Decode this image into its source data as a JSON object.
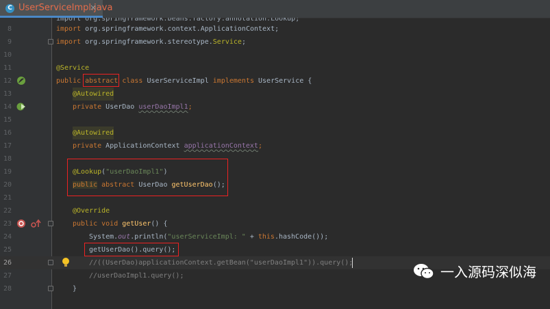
{
  "tab": {
    "title": "UserServiceImpl.java",
    "icon": "C"
  },
  "lines": {
    "7": "import org.springframework.beans.factory.annotation.Lookup;",
    "8": "8",
    "9": "9",
    "11": "11",
    "12": "12",
    "13": "13",
    "14": "14",
    "15": "15",
    "16": "16",
    "17": "17",
    "18": "18",
    "19": "19",
    "20": "20",
    "21": "21",
    "22": "22",
    "23": "23",
    "24": "24",
    "25": "25",
    "26": "26",
    "27": "27",
    "28": "28",
    "10": "10"
  },
  "code": {
    "l8_import": "import",
    "l8_path": " org.springframework.context.ApplicationContext;",
    "l9_import": "import",
    "l9_path": " org.springframework.stereotype.",
    "l9_service": "Service",
    "l9_end": ";",
    "l11": "@Service",
    "l12_public": "public",
    "l12_abstract": "abstract",
    "l12_class": " class",
    "l12_name": " UserServiceImpl ",
    "l12_implements": "implements",
    "l12_rest": " UserService {",
    "l13": "@Autowired",
    "l14_private": "private",
    "l14_type": " UserDao ",
    "l14_field": "userDaoImpl1",
    "l14_end": ";",
    "l16": "@Autowired",
    "l17_private": "private",
    "l17_type": " ApplicationContext ",
    "l17_field": "applicationContext",
    "l17_end": ";",
    "l19_ann": "@Lookup",
    "l19_open": "(",
    "l19_str": "\"userDaoImpl1\"",
    "l19_close": ")",
    "l20_public": "public",
    "l20_abstract": " abstract",
    "l20_type": " UserDao ",
    "l20_method": "getUserDao",
    "l20_end": "();",
    "l22": "@Override",
    "l23_public": "public",
    "l23_void": " void ",
    "l23_method": "getUser",
    "l23_end": "() {",
    "l24_sys": "System.",
    "l24_out": "out",
    "l24_println": ".println(",
    "l24_str": "\"userServiceImpl: \"",
    "l24_plus": " + ",
    "l24_this": "this",
    "l24_end": ".hashCode());",
    "l25": "getUserDao().query();",
    "l26": "//((UserDao)applicationContext.getBean(\"userDaoImpl1\")).query();",
    "l27": "//userDaoImpl1.query();",
    "l28": "}"
  },
  "watermark": {
    "text": "一入源码深似海"
  },
  "colors": {
    "keyword": "#cc7832",
    "annotation": "#bbb529",
    "string": "#6a8759",
    "comment": "#808080",
    "highlight_box": "#ee2222",
    "tab_text": "#e46c4a"
  }
}
